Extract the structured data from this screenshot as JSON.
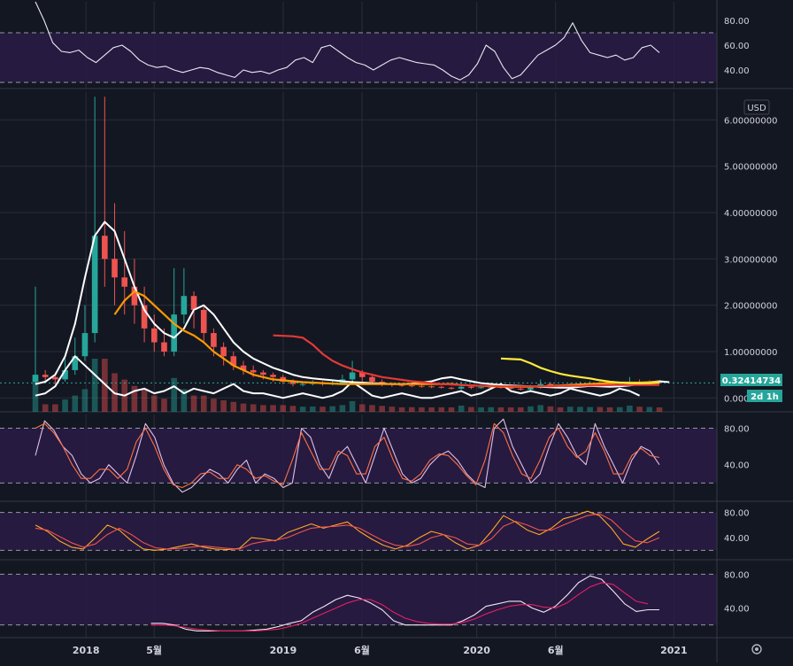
{
  "colors": {
    "background": "#131722",
    "band": "#2a1b45",
    "grid": "#2a2e39",
    "axis_text": "#d1d4dc",
    "up": "#26a69a",
    "down": "#ef5350",
    "price_tag": "#26a69a",
    "white": "#ffffff",
    "orange": "#ff9800",
    "red": "#e53935",
    "yellow": "#ffeb3b",
    "stoch_k": "#e1bee7",
    "stoch_d": "#ff7043",
    "macd_a": "#ffa726",
    "macd_b": "#ef5350",
    "slow_a": "#f3e5f5",
    "slow_b": "#e91e63"
  },
  "currency_label": "USD",
  "last_price": "0.32414734",
  "countdown": "2d 1h",
  "settings_icon": "gear-icon",
  "chart_data": [
    {
      "type": "line",
      "name": "rsi",
      "yticks": [
        "80.00",
        "60.00",
        "40.00"
      ],
      "ylim": [
        25,
        95
      ],
      "band": [
        30,
        70
      ],
      "values": [
        95,
        80,
        62,
        55,
        54,
        56,
        50,
        46,
        52,
        58,
        60,
        55,
        48,
        44,
        42,
        43,
        40,
        38,
        40,
        42,
        41,
        38,
        36,
        34,
        40,
        38,
        39,
        37,
        40,
        42,
        48,
        50,
        46,
        58,
        60,
        55,
        50,
        46,
        44,
        40,
        44,
        48,
        50,
        48,
        46,
        45,
        44,
        40,
        35,
        32,
        36,
        45,
        60,
        55,
        42,
        33,
        36,
        44,
        52,
        56,
        60,
        66,
        78,
        64,
        54,
        52,
        50,
        52,
        48,
        50,
        58,
        60,
        54
      ]
    },
    {
      "type": "candlestick",
      "name": "price",
      "yticks": [
        "6.00000000",
        "5.00000000",
        "4.00000000",
        "3.00000000",
        "2.00000000",
        "1.00000000",
        "0.00000000"
      ],
      "ylim": [
        -0.3,
        6.6
      ],
      "candles": [
        [
          0.35,
          0.5,
          2.4,
          0.3
        ],
        [
          0.5,
          0.45,
          0.6,
          0.35
        ],
        [
          0.45,
          0.4,
          0.55,
          0.3
        ],
        [
          0.4,
          0.6,
          0.9,
          0.35
        ],
        [
          0.6,
          0.9,
          1.3,
          0.5
        ],
        [
          0.9,
          1.4,
          2.0,
          0.8
        ],
        [
          1.4,
          3.5,
          6.5,
          1.2
        ],
        [
          3.5,
          3.0,
          6.5,
          2.4
        ],
        [
          3.0,
          2.6,
          4.2,
          2.0
        ],
        [
          2.6,
          2.4,
          3.6,
          1.8
        ],
        [
          2.4,
          2.0,
          3.0,
          1.6
        ],
        [
          2.0,
          1.5,
          2.4,
          1.2
        ],
        [
          1.5,
          1.2,
          1.8,
          1.0
        ],
        [
          1.2,
          1.0,
          1.5,
          0.9
        ],
        [
          1.0,
          1.8,
          2.8,
          0.9
        ],
        [
          1.8,
          2.2,
          2.8,
          1.6
        ],
        [
          2.2,
          1.9,
          2.3,
          1.5
        ],
        [
          1.9,
          1.4,
          2.0,
          1.2
        ],
        [
          1.4,
          1.1,
          1.5,
          0.9
        ],
        [
          1.1,
          0.9,
          1.2,
          0.7
        ],
        [
          0.9,
          0.7,
          1.0,
          0.6
        ],
        [
          0.7,
          0.6,
          0.8,
          0.5
        ],
        [
          0.6,
          0.55,
          0.7,
          0.45
        ],
        [
          0.55,
          0.5,
          0.6,
          0.4
        ],
        [
          0.5,
          0.45,
          0.55,
          0.35
        ],
        [
          0.45,
          0.35,
          0.5,
          0.3
        ],
        [
          0.35,
          0.3,
          0.4,
          0.25
        ],
        [
          0.3,
          0.3,
          0.35,
          0.25
        ],
        [
          0.3,
          0.32,
          0.38,
          0.27
        ],
        [
          0.32,
          0.3,
          0.36,
          0.26
        ],
        [
          0.3,
          0.32,
          0.4,
          0.27
        ],
        [
          0.32,
          0.4,
          0.5,
          0.3
        ],
        [
          0.4,
          0.55,
          0.8,
          0.35
        ],
        [
          0.55,
          0.45,
          0.6,
          0.35
        ],
        [
          0.45,
          0.35,
          0.5,
          0.3
        ],
        [
          0.35,
          0.3,
          0.4,
          0.25
        ],
        [
          0.3,
          0.28,
          0.34,
          0.24
        ],
        [
          0.28,
          0.27,
          0.3,
          0.24
        ],
        [
          0.27,
          0.26,
          0.3,
          0.23
        ],
        [
          0.26,
          0.25,
          0.28,
          0.22
        ],
        [
          0.25,
          0.24,
          0.27,
          0.21
        ],
        [
          0.24,
          0.22,
          0.26,
          0.2
        ],
        [
          0.22,
          0.2,
          0.24,
          0.18
        ],
        [
          0.2,
          0.24,
          0.35,
          0.18
        ],
        [
          0.24,
          0.22,
          0.27,
          0.19
        ],
        [
          0.22,
          0.23,
          0.26,
          0.2
        ],
        [
          0.23,
          0.24,
          0.28,
          0.21
        ],
        [
          0.24,
          0.22,
          0.26,
          0.2
        ],
        [
          0.22,
          0.2,
          0.24,
          0.18
        ],
        [
          0.2,
          0.18,
          0.22,
          0.16
        ],
        [
          0.18,
          0.22,
          0.28,
          0.16
        ],
        [
          0.22,
          0.3,
          0.4,
          0.2
        ],
        [
          0.3,
          0.25,
          0.34,
          0.22
        ],
        [
          0.25,
          0.24,
          0.28,
          0.22
        ],
        [
          0.24,
          0.28,
          0.32,
          0.22
        ],
        [
          0.28,
          0.3,
          0.35,
          0.26
        ],
        [
          0.3,
          0.32,
          0.36,
          0.28
        ],
        [
          0.32,
          0.3,
          0.35,
          0.27
        ],
        [
          0.3,
          0.28,
          0.32,
          0.26
        ],
        [
          0.28,
          0.3,
          0.33,
          0.26
        ],
        [
          0.3,
          0.35,
          0.45,
          0.28
        ],
        [
          0.35,
          0.32,
          0.4,
          0.3
        ],
        [
          0.32,
          0.34,
          0.38,
          0.3
        ],
        [
          0.34,
          0.33,
          0.36,
          0.3
        ]
      ],
      "overlays": [
        {
          "color_key": "white",
          "start": 0,
          "values": [
            0.3,
            0.35,
            0.5,
            0.9,
            1.6,
            2.6,
            3.5,
            3.8,
            3.6,
            3.0,
            2.4,
            1.9,
            1.6,
            1.4,
            1.3,
            1.5,
            1.9,
            2.0,
            1.8,
            1.5,
            1.2,
            1.0,
            0.85,
            0.75,
            0.65,
            0.58,
            0.5,
            0.45,
            0.42,
            0.4,
            0.38,
            0.36,
            0.34,
            0.33,
            0.32,
            0.31,
            0.3,
            0.3,
            0.31,
            0.33,
            0.36,
            0.42,
            0.45,
            0.4,
            0.36,
            0.32,
            0.3,
            0.28,
            0.27,
            0.26,
            0.25,
            0.24,
            0.23,
            0.22,
            0.22,
            0.24,
            0.26,
            0.25,
            0.24,
            0.25,
            0.27,
            0.3,
            0.34,
            0.36,
            0.34
          ]
        },
        {
          "color_key": "white",
          "start": 0,
          "values": [
            0.05,
            0.1,
            0.25,
            0.6,
            0.9,
            0.7,
            0.5,
            0.3,
            0.1,
            0.05,
            0.15,
            0.2,
            0.1,
            0.15,
            0.25,
            0.1,
            0.2,
            0.15,
            0.1,
            0.2,
            0.3,
            0.15,
            0.1,
            0.1,
            0.05,
            0.0,
            0.05,
            0.1,
            0.05,
            0.0,
            0.05,
            0.15,
            0.35,
            0.2,
            0.05,
            0.0,
            0.05,
            0.1,
            0.05,
            0.0,
            0.0,
            0.05,
            0.1,
            0.15,
            0.05,
            0.1,
            0.2,
            0.3,
            0.15,
            0.1,
            0.15,
            0.1,
            0.05,
            0.1,
            0.2,
            0.15,
            0.1,
            0.05,
            0.1,
            0.2,
            0.15,
            0.05
          ]
        },
        {
          "color_key": "orange",
          "start": 8,
          "values": [
            1.8,
            2.1,
            2.3,
            2.2,
            2.0,
            1.8,
            1.6,
            1.45,
            1.35,
            1.2,
            1.0,
            0.85,
            0.7,
            0.6,
            0.5,
            0.45,
            0.4,
            0.38,
            0.36,
            0.34,
            0.33,
            0.32,
            0.31,
            0.3,
            0.3,
            0.3,
            0.3,
            0.3,
            0.3,
            0.3,
            0.3,
            0.3,
            0.3,
            0.3,
            0.3,
            0.28,
            0.27,
            0.26,
            0.25,
            0.24,
            0.24,
            0.24,
            0.24,
            0.25,
            0.26,
            0.27,
            0.28,
            0.29,
            0.3,
            0.31,
            0.32,
            0.33,
            0.33,
            0.33,
            0.34,
            0.34
          ]
        },
        {
          "color_key": "red",
          "start": 24,
          "values": [
            1.35,
            1.34,
            1.33,
            1.3,
            1.15,
            0.95,
            0.8,
            0.7,
            0.62,
            0.55,
            0.5,
            0.45,
            0.42,
            0.39,
            0.36,
            0.34,
            0.32,
            0.3,
            0.29,
            0.28,
            0.27,
            0.26,
            0.26,
            0.25,
            0.25,
            0.25,
            0.25,
            0.25,
            0.25,
            0.26,
            0.26,
            0.26,
            0.27,
            0.27,
            0.28,
            0.28,
            0.28,
            0.28,
            0.28,
            0.28
          ]
        },
        {
          "color_key": "yellow",
          "start": 47,
          "values": [
            0.85,
            0.84,
            0.83,
            0.75,
            0.65,
            0.58,
            0.52,
            0.48,
            0.45,
            0.42,
            0.38,
            0.35,
            0.33,
            0.32,
            0.32,
            0.32,
            0.33
          ]
        }
      ]
    },
    {
      "type": "line",
      "name": "stochastic",
      "yticks": [
        "80.00",
        "40.00"
      ],
      "ylim": [
        0,
        95
      ],
      "band": [
        20,
        80
      ],
      "series": [
        {
          "color_key": "stoch_k",
          "values": [
            50,
            88,
            78,
            60,
            50,
            30,
            20,
            25,
            40,
            30,
            20,
            50,
            85,
            70,
            40,
            20,
            10,
            15,
            25,
            35,
            30,
            20,
            35,
            45,
            20,
            30,
            25,
            15,
            20,
            80,
            70,
            40,
            25,
            50,
            60,
            40,
            20,
            50,
            80,
            55,
            30,
            20,
            25,
            40,
            50,
            55,
            45,
            30,
            20,
            15,
            80,
            90,
            60,
            40,
            20,
            30,
            60,
            85,
            70,
            50,
            40,
            85,
            60,
            40,
            20,
            45,
            60,
            55,
            40
          ]
        },
        {
          "color_key": "stoch_d",
          "values": [
            80,
            85,
            75,
            60,
            40,
            25,
            25,
            35,
            35,
            25,
            35,
            65,
            80,
            60,
            35,
            18,
            15,
            20,
            30,
            32,
            25,
            25,
            40,
            35,
            25,
            28,
            22,
            18,
            45,
            75,
            55,
            35,
            35,
            55,
            50,
            30,
            30,
            60,
            70,
            45,
            25,
            22,
            30,
            45,
            52,
            50,
            40,
            28,
            18,
            45,
            85,
            75,
            50,
            30,
            25,
            45,
            70,
            80,
            60,
            48,
            55,
            75,
            55,
            30,
            30,
            50,
            58,
            50,
            48
          ]
        }
      ]
    },
    {
      "type": "line",
      "name": "macd-oscillator",
      "yticks": [
        "80.00",
        "40.00"
      ],
      "ylim": [
        5,
        95
      ],
      "band": [
        20,
        80
      ],
      "series": [
        {
          "color_key": "macd_a",
          "values": [
            60,
            50,
            35,
            25,
            22,
            40,
            60,
            52,
            35,
            22,
            20,
            22,
            26,
            30,
            25,
            22,
            21,
            23,
            40,
            38,
            35,
            48,
            55,
            62,
            55,
            60,
            65,
            50,
            38,
            28,
            22,
            28,
            40,
            50,
            45,
            32,
            22,
            28,
            50,
            75,
            65,
            52,
            45,
            55,
            70,
            75,
            82,
            75,
            55,
            30,
            25,
            38,
            50
          ]
        },
        {
          "color_key": "macd_b",
          "values": [
            55,
            52,
            42,
            32,
            25,
            30,
            45,
            55,
            45,
            32,
            24,
            22,
            23,
            25,
            27,
            25,
            23,
            22,
            30,
            34,
            36,
            40,
            48,
            55,
            57,
            58,
            60,
            55,
            45,
            35,
            28,
            26,
            30,
            40,
            45,
            40,
            30,
            28,
            38,
            58,
            66,
            60,
            52,
            52,
            60,
            68,
            75,
            78,
            68,
            50,
            35,
            32,
            40
          ]
        }
      ]
    },
    {
      "type": "line",
      "name": "slow-oscillator",
      "yticks": [
        "80.00",
        "40.00"
      ],
      "ylim": [
        5,
        95
      ],
      "band": [
        20,
        80
      ],
      "series": [
        {
          "color_key": "slow_a",
          "start": 10,
          "values": [
            22,
            22,
            20,
            15,
            13,
            13,
            13,
            13,
            13,
            14,
            15,
            18,
            22,
            25,
            35,
            42,
            50,
            55,
            52,
            46,
            38,
            25,
            20,
            20,
            20,
            20,
            20,
            25,
            32,
            42,
            45,
            48,
            48,
            40,
            35,
            42,
            55,
            70,
            78,
            74,
            60,
            45,
            36,
            38,
            38
          ]
        },
        {
          "color_key": "slow_b",
          "start": 10,
          "values": [
            20,
            20,
            19,
            17,
            15,
            14,
            13,
            13,
            13,
            13,
            14,
            15,
            18,
            22,
            28,
            34,
            40,
            46,
            50,
            50,
            44,
            35,
            28,
            24,
            22,
            21,
            21,
            23,
            27,
            33,
            38,
            42,
            44,
            44,
            41,
            40,
            46,
            56,
            65,
            70,
            68,
            58,
            48,
            45
          ]
        }
      ]
    },
    {
      "type": "axis",
      "name": "time-axis",
      "labels": [
        {
          "label": "2018",
          "pos": 0.12
        },
        {
          "label": "5월",
          "pos": 0.215
        },
        {
          "label": "2019",
          "pos": 0.395
        },
        {
          "label": "6월",
          "pos": 0.505
        },
        {
          "label": "2020",
          "pos": 0.665
        },
        {
          "label": "6월",
          "pos": 0.775
        },
        {
          "label": "2021",
          "pos": 0.94
        }
      ]
    }
  ]
}
